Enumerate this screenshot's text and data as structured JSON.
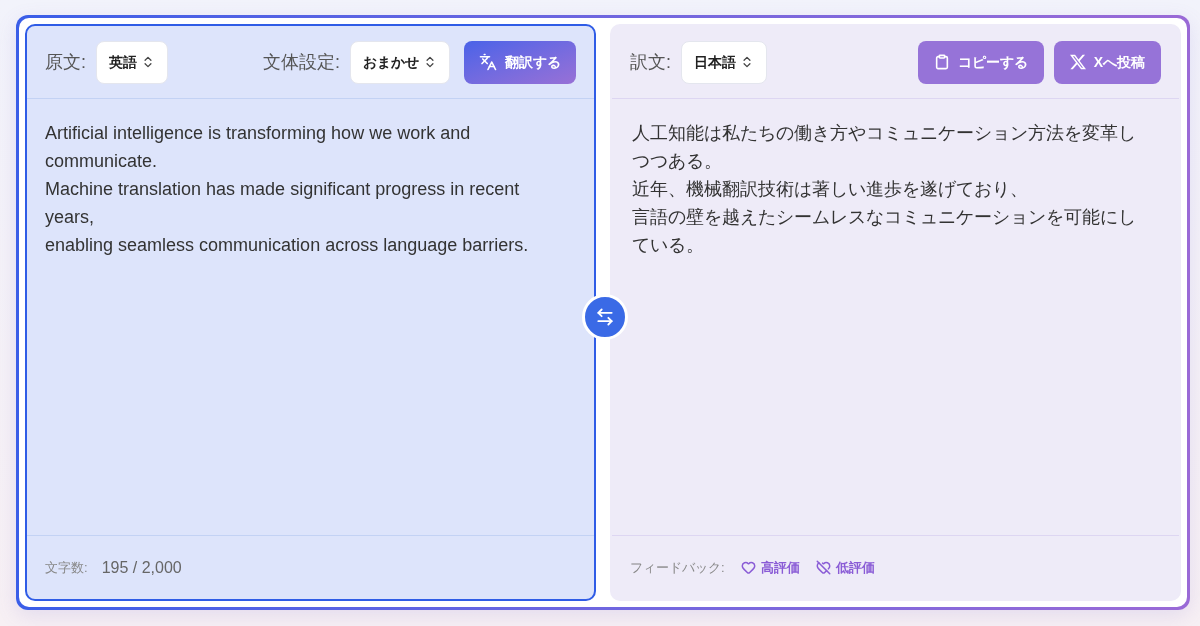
{
  "source_panel": {
    "focused": true,
    "label": "原文:",
    "language": "英語",
    "style_label": "文体設定:",
    "style": "おまかせ",
    "translate_button": "翻訳する",
    "text": "Artificial intelligence is transforming how we work and communicate.\nMachine translation has made significant progress in recent years,\nenabling seamless communication across language barriers.",
    "char_count_label": "文字数:",
    "char_count": "195 / 2,000"
  },
  "target_panel": {
    "focused": false,
    "label": "訳文:",
    "language": "日本語",
    "buttons": [
      {
        "kind": "copy",
        "label": "コピーする"
      },
      {
        "kind": "post_x",
        "label": "Xへ投稿"
      }
    ],
    "text_lines": [
      "人工知能は私たちの働き方やコミュニケーション方法を変革しつつある。",
      "近年、機械翻訳技術は著しい進歩を遂げており、",
      "言語の壁を越えたシームレスなコミュニケーションを可能にしている。"
    ],
    "feedback_label": "フィードバック:",
    "feedback": [
      {
        "kind": "like",
        "label": "高評価"
      },
      {
        "kind": "dislike",
        "label": "低評価"
      }
    ]
  }
}
